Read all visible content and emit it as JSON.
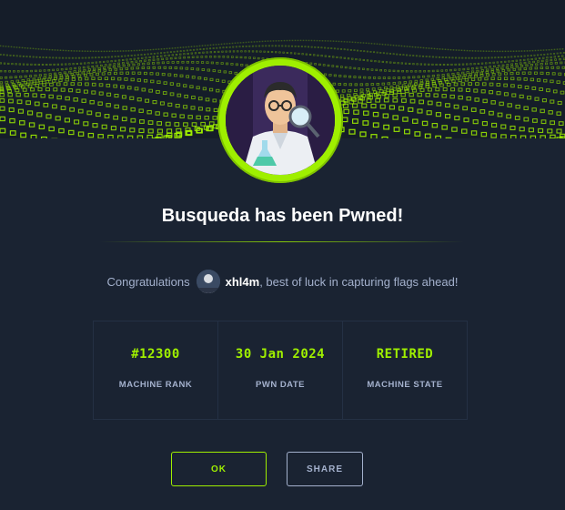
{
  "dialog": {
    "machine_name": "Busqueda",
    "title": "Busqueda has been Pwned!",
    "congrats_prefix": "Congratulations",
    "username": "xhl4m",
    "congrats_suffix": ", best of luck in capturing flags ahead!"
  },
  "stats": [
    {
      "value": "#12300",
      "label": "MACHINE RANK"
    },
    {
      "value": "30 Jan 2024",
      "label": "PWN DATE"
    },
    {
      "value": "RETIRED",
      "label": "MACHINE STATE"
    }
  ],
  "buttons": {
    "ok_label": "OK",
    "share_label": "SHARE"
  },
  "colors": {
    "accent": "#9fef00",
    "background": "#1a2332",
    "muted_text": "#a4b1cd"
  }
}
